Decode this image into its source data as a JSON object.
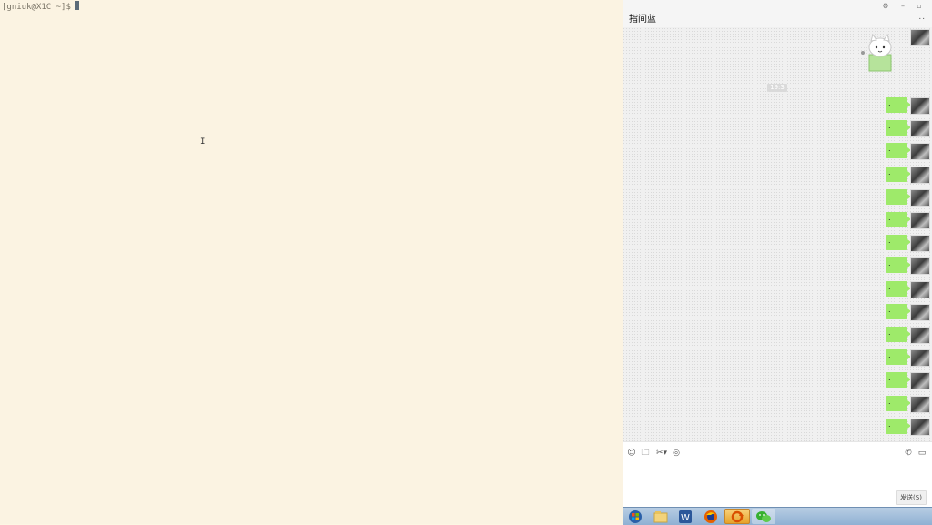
{
  "terminal": {
    "prompt": "[gniuk@X1C ~]$",
    "cursor_icon": "text-cursor-icon"
  },
  "chat": {
    "title": "指间蓝",
    "window_controls": [
      "gear-icon",
      "minimize-icon",
      "maximize-icon"
    ],
    "more_label": "...",
    "time_separator": "19:3",
    "messages": [
      {
        "text": "."
      },
      {
        "text": "."
      },
      {
        "text": "."
      },
      {
        "text": "."
      },
      {
        "text": "."
      },
      {
        "text": "."
      },
      {
        "text": "."
      },
      {
        "text": "."
      },
      {
        "text": "."
      },
      {
        "text": "."
      },
      {
        "text": "."
      },
      {
        "text": "."
      },
      {
        "text": "."
      },
      {
        "text": "."
      },
      {
        "text": "."
      }
    ],
    "bubble_color": "#9eea6a",
    "toolbar": {
      "tools": [
        "emoji-icon",
        "folder-icon",
        "scissors-icon",
        "chat-history-icon"
      ],
      "right_tools": [
        "phone-icon",
        "video-icon"
      ]
    },
    "send_label": "发送(S)"
  },
  "taskbar": {
    "apps": [
      "windows-start-icon",
      "file-explorer-icon",
      "word-icon",
      "firefox-icon",
      "refresh-app-icon",
      "wechat-icon"
    ]
  }
}
